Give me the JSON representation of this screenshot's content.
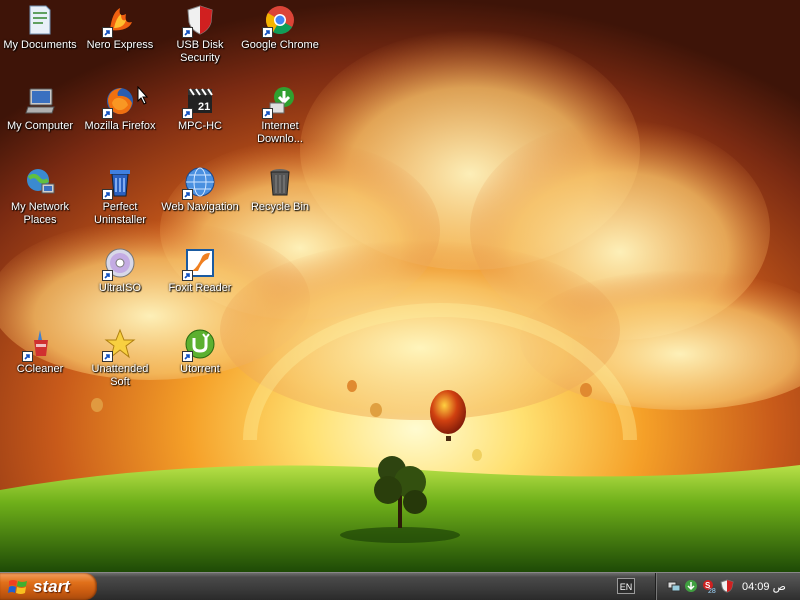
{
  "desktop": {
    "icons": [
      {
        "label": "My Documents",
        "icon": "my-documents-icon",
        "shortcut": false
      },
      {
        "label": "Nero Express",
        "icon": "nero-express-icon",
        "shortcut": true
      },
      {
        "label": "USB Disk Security",
        "icon": "usb-disk-security-icon",
        "shortcut": true
      },
      {
        "label": "Google Chrome",
        "icon": "google-chrome-icon",
        "shortcut": true
      },
      {
        "label": "My Computer",
        "icon": "my-computer-icon",
        "shortcut": false
      },
      {
        "label": "Mozilla Firefox",
        "icon": "mozilla-firefox-icon",
        "shortcut": true
      },
      {
        "label": "MPC-HC",
        "icon": "mpc-hc-icon",
        "shortcut": true
      },
      {
        "label": "Internet Downlo...",
        "icon": "internet-download-manager-icon",
        "shortcut": true
      },
      {
        "label": "My Network Places",
        "icon": "my-network-places-icon",
        "shortcut": false
      },
      {
        "label": "Perfect Uninstaller",
        "icon": "perfect-uninstaller-icon",
        "shortcut": true
      },
      {
        "label": "Web Navigation",
        "icon": "web-navigation-icon",
        "shortcut": true
      },
      {
        "label": "Recycle Bin",
        "icon": "recycle-bin-icon",
        "shortcut": false
      },
      {
        "label": "UltraISO",
        "icon": "ultraiso-icon",
        "shortcut": true
      },
      {
        "label": "Foxit Reader",
        "icon": "foxit-reader-icon",
        "shortcut": true
      },
      {
        "label": "CCleaner",
        "icon": "ccleaner-icon",
        "shortcut": true
      },
      {
        "label": "Unattended Soft",
        "icon": "unattended-soft-icon",
        "shortcut": true
      },
      {
        "label": "Utorrent",
        "icon": "utorrent-icon",
        "shortcut": true
      }
    ]
  },
  "taskbar": {
    "start_label": "start",
    "language": "EN",
    "tray_badge": "28",
    "clock": "04:09 ص"
  }
}
